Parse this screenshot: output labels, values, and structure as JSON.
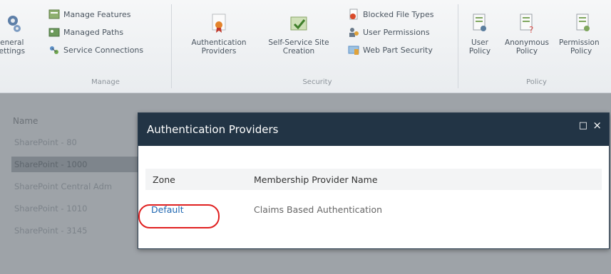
{
  "ribbon": {
    "general_settings": {
      "line1": "General",
      "line2": "Settings ▾"
    },
    "manage": {
      "label": "Manage",
      "items": [
        "Manage Features",
        "Managed Paths",
        "Service Connections"
      ]
    },
    "security": {
      "label": "Security",
      "big": [
        {
          "line1": "Authentication",
          "line2": "Providers"
        },
        {
          "line1": "Self-Service Site",
          "line2": "Creation"
        }
      ],
      "items": [
        "Blocked File Types",
        "User Permissions",
        "Web Part Security"
      ]
    },
    "policy": {
      "label": "Policy",
      "big": [
        {
          "line1": "User",
          "line2": "Policy"
        },
        {
          "line1": "Anonymous",
          "line2": "Policy"
        },
        {
          "line1": "Permission",
          "line2": "Policy"
        }
      ]
    }
  },
  "list": {
    "column_header": "Name",
    "rows": [
      "SharePoint - 80",
      "SharePoint - 1000",
      "SharePoint Central Adm",
      "SharePoint - 1010",
      "SharePoint - 3145"
    ],
    "selected_index": 1
  },
  "dialog": {
    "title": "Authentication Providers",
    "maximize_glyph": "□",
    "close_glyph": "×",
    "headers": {
      "zone": "Zone",
      "provider": "Membership Provider Name"
    },
    "rows": [
      {
        "zone": "Default",
        "provider": "Claims Based Authentication"
      }
    ]
  },
  "colors": {
    "dialog_title_bg": "#223445",
    "link": "#1f67b1",
    "highlight": "#e02020"
  }
}
